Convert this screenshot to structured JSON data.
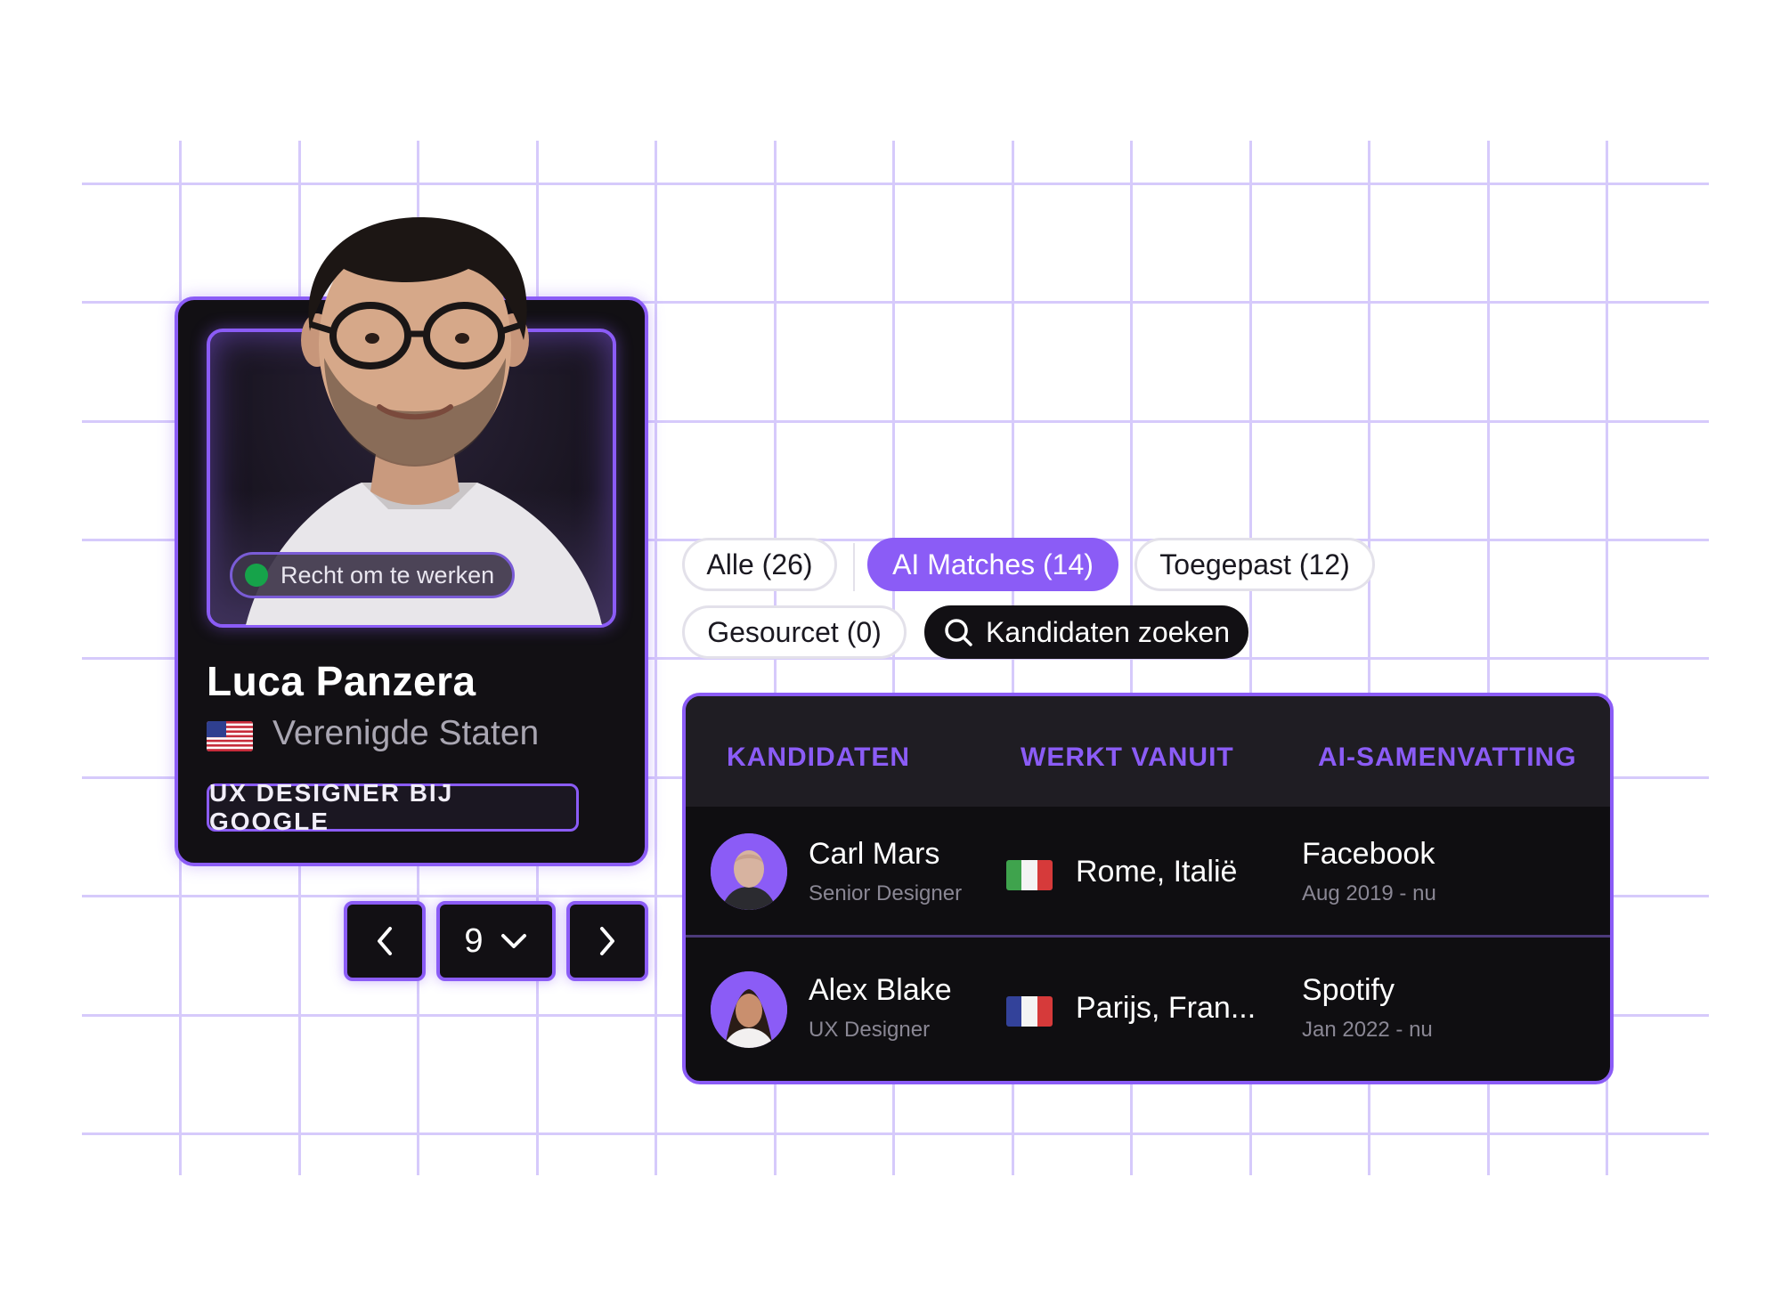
{
  "profile": {
    "work_badge": "Recht om te werken",
    "name": "Luca Panzera",
    "country": "Verenigde Staten",
    "job": "UX DESIGNER BIJ GOOGLE"
  },
  "pagination": {
    "page": "9"
  },
  "filters": {
    "all": "Alle (26)",
    "ai_matches": "AI Matches (14)",
    "applied": "Toegepast (12)",
    "sourced": "Gesourcet (0)",
    "search": "Kandidaten zoeken"
  },
  "table": {
    "headers": [
      "KANDIDATEN",
      "WERKT VANUIT",
      "AI-SAMENVATTING"
    ],
    "rows": [
      {
        "name": "Carl Mars",
        "role": "Senior Designer",
        "location": "Rome, Italië",
        "company": "Facebook",
        "period": "Aug 2019 - nu",
        "flag": "italy-flag"
      },
      {
        "name": "Alex Blake",
        "role": "UX Designer",
        "location": "Parijs, Fran...",
        "company": "Spotify",
        "period": "Jan 2022 - nu",
        "flag": "france-flag"
      }
    ]
  },
  "colors": {
    "accent": "#8b5cf6",
    "dark": "#121014",
    "grid": "#d6cafb",
    "status": "#16a34a"
  }
}
